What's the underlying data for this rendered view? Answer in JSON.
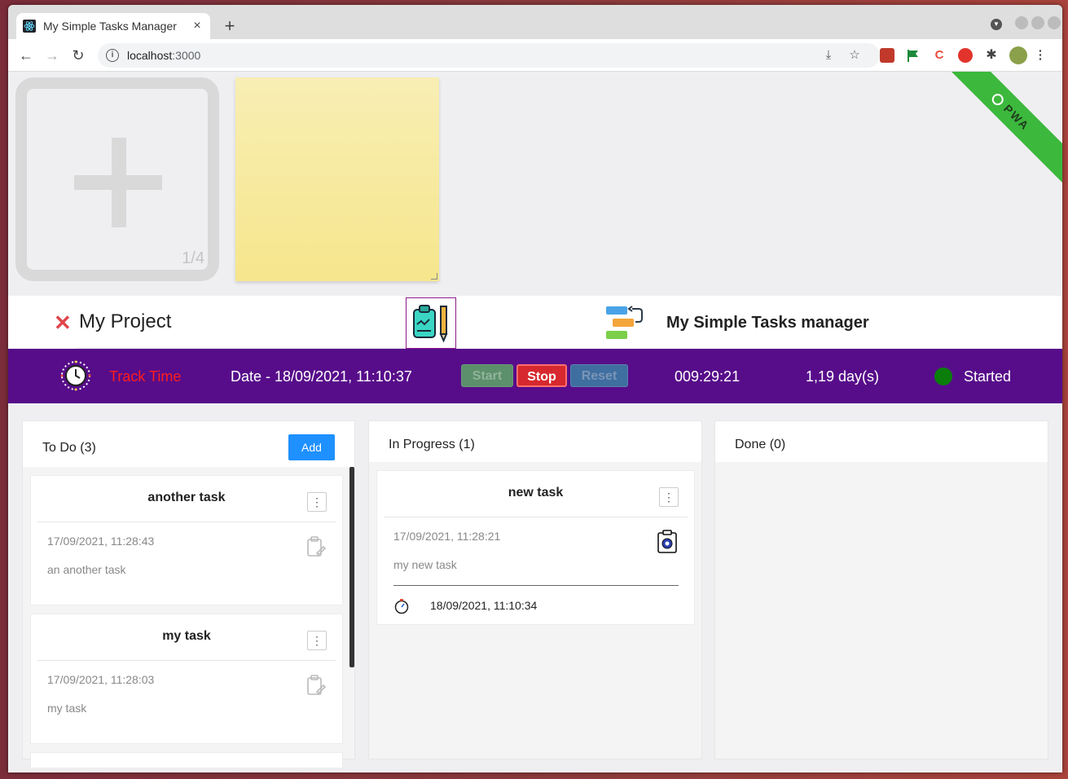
{
  "browser": {
    "tab_title": "My Simple Tasks Manager",
    "tab_close": "×",
    "new_tab": "+",
    "url_host": "localhost",
    "url_port": ":3000"
  },
  "notes": {
    "add_count": "1/4"
  },
  "ribbon": {
    "label": "PWA",
    "color": "#3cb83c"
  },
  "header": {
    "project_close": "✕",
    "project_title": "My Project",
    "app_name": "My Simple Tasks manager"
  },
  "timebar": {
    "track_label": "Track Time",
    "date_text": "Date - 18/09/2021, 11:10:37",
    "start_label": "Start",
    "stop_label": "Stop",
    "reset_label": "Reset",
    "elapsed": "009:29:21",
    "days": "1,19 day(s)",
    "status": "Started",
    "bar_color": "#570d8a",
    "status_color": "#0b7d0b"
  },
  "board": {
    "todo": {
      "title": "To Do (3)",
      "add_label": "Add",
      "cards": [
        {
          "title": "another task",
          "menu": "⋮",
          "date": "17/09/2021, 11:28:43",
          "desc": "an another task"
        },
        {
          "title": "my task",
          "menu": "⋮",
          "date": "17/09/2021, 11:28:03",
          "desc": "my task"
        }
      ]
    },
    "in_progress": {
      "title": "In Progress (1)",
      "cards": [
        {
          "title": "new task",
          "menu": "⋮",
          "date": "17/09/2021, 11:28:21",
          "desc": "my new task",
          "started": "18/09/2021, 11:10:34"
        }
      ]
    },
    "done": {
      "title": "Done (0)"
    }
  }
}
